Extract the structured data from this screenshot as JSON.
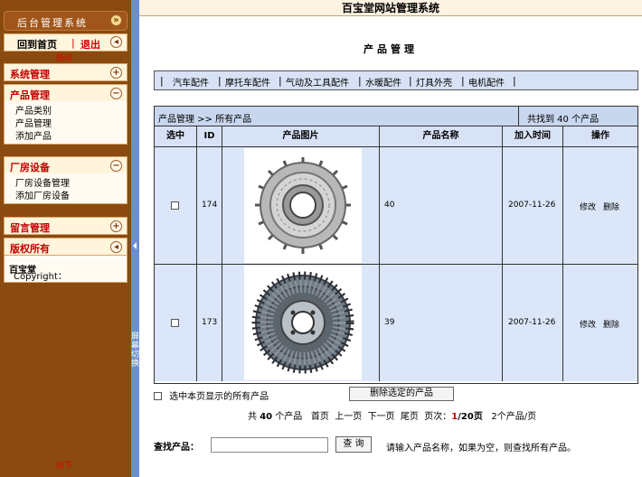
{
  "sidebar": {
    "header_title": "后台管理系统",
    "home_link": "回到首页",
    "separator": "|",
    "logout_link": "退出",
    "red_note_top": "拖动",
    "red_note_bottom": "向下",
    "sections": [
      {
        "label": "系统管理",
        "toggle": "+"
      },
      {
        "label": "产品管理",
        "toggle": "−",
        "items": [
          "产品类别",
          "产品管理",
          "添加产品"
        ]
      },
      {
        "label": "厂房设备",
        "toggle": "−",
        "items": [
          "厂房设备管理",
          "添加厂房设备"
        ]
      },
      {
        "label": "留言管理",
        "toggle": "+"
      },
      {
        "label": "版权所有",
        "toggle": "◂"
      }
    ],
    "copyright_label": "Copyright：",
    "copyright_value": "百宝堂"
  },
  "splitter": {
    "label": "屏幕切换"
  },
  "topbar": {
    "title": "百宝堂网站管理系统"
  },
  "page_title": "产品管理",
  "categories": [
    "汽车配件",
    "摩托车配件",
    "气动及工具配件",
    "水暖配件",
    "灯具外壳",
    "电机配件"
  ],
  "table": {
    "breadcrumb": "产品管理 >> 所有产品",
    "found_count": "共找到 40 个产品",
    "columns": [
      "选中",
      "ID",
      "产品图片",
      "产品名称",
      "加入时间",
      "操作"
    ],
    "rows": [
      {
        "id": "174",
        "image_icon": "fan-clutch-gear-image",
        "name": "40",
        "date": "2007-11-26",
        "edit": "修改",
        "delete": "删除"
      },
      {
        "id": "173",
        "image_icon": "fan-clutch-finned-image",
        "name": "39",
        "date": "2007-11-26",
        "edit": "修改",
        "delete": "删除"
      }
    ]
  },
  "select_all_label": "选中本页显示的所有产品",
  "delete_selected_button": "删除选定的产品",
  "pager": {
    "total_prefix": "共",
    "total": "40",
    "total_suffix": "个产品",
    "first": "首页",
    "prev": "上一页",
    "next": "下一页",
    "last": "尾页",
    "page_label": "页次：",
    "current_page": "1",
    "total_pages": "/20页",
    "per_page": "2个产品/页"
  },
  "search": {
    "label": "查找产品：",
    "value": "",
    "button": "查 询",
    "hint": "请输入产品名称，如果为空，则查找所有产品。"
  },
  "colors": {
    "sidebar_bg": "#8a4a10",
    "splitter": "#6a8fd6",
    "header_blue": "#c8d6ee",
    "row_blue": "#dbe6f9",
    "accent_red": "#c00000"
  }
}
